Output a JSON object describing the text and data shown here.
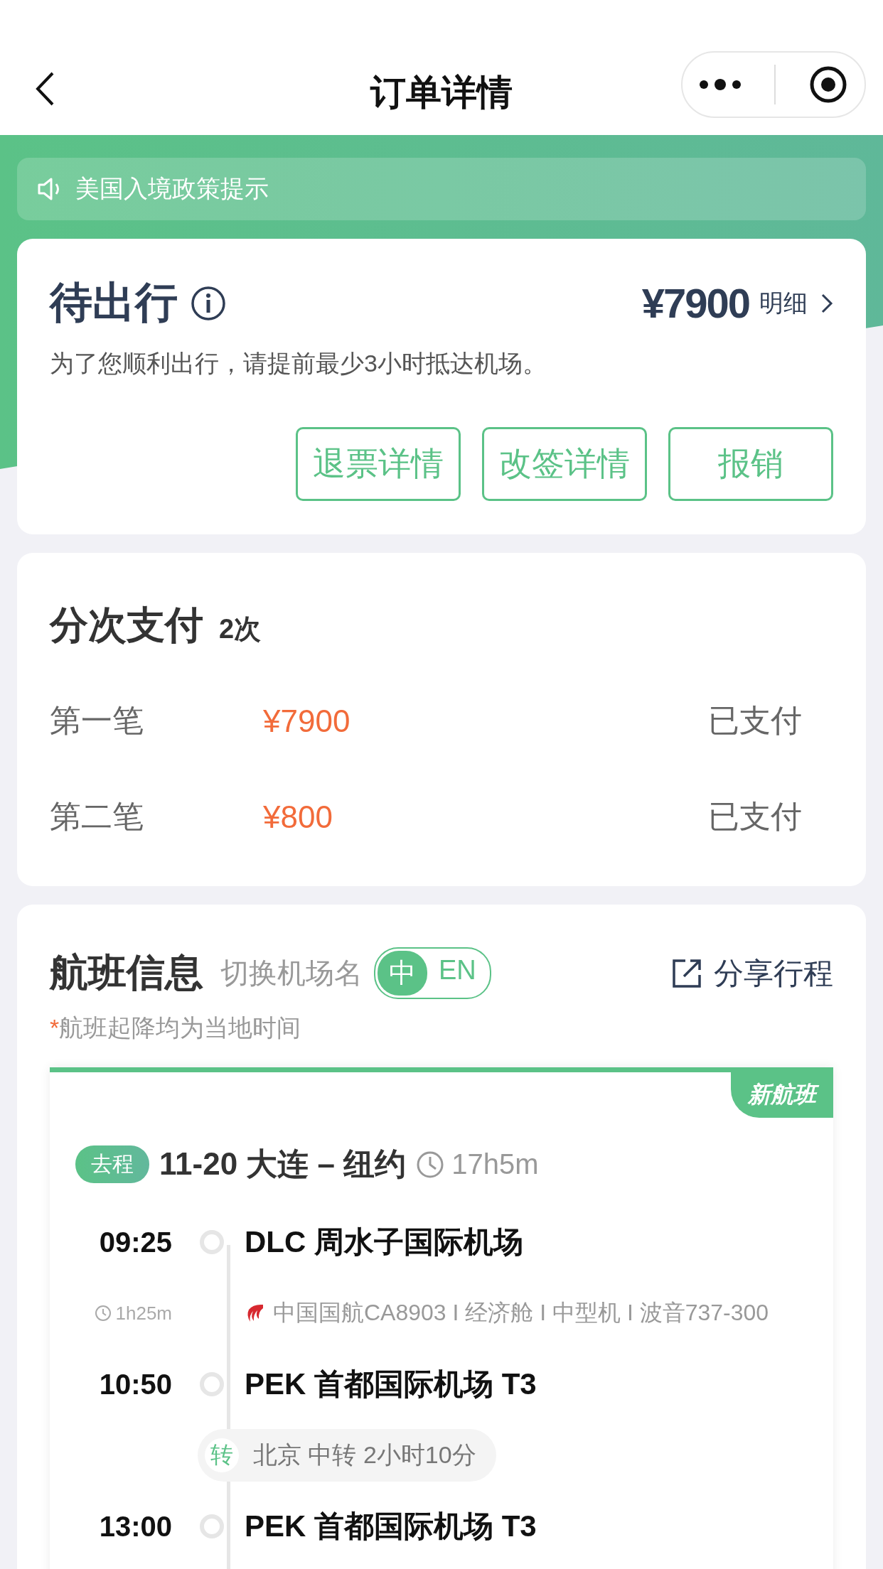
{
  "nav": {
    "title": "订单详情"
  },
  "notice": {
    "text": "美国入境政策提示"
  },
  "order": {
    "status": "待出行",
    "price": "¥7900",
    "detail_link": "明细",
    "hint": "为了您顺利出行，请提前最少3小时抵达机场。",
    "buttons": [
      "退票详情",
      "改签详情",
      "报销"
    ]
  },
  "payments": {
    "title": "分次支付",
    "count": "2次",
    "rows": [
      {
        "label": "第一笔",
        "amount": "¥7900",
        "status": "已支付"
      },
      {
        "label": "第二笔",
        "amount": "¥800",
        "status": "已支付"
      }
    ]
  },
  "flight": {
    "title": "航班信息",
    "switch_label": "切换机场名",
    "language_options": [
      {
        "label": "中",
        "selected": true
      },
      {
        "label": "EN",
        "selected": false
      }
    ],
    "share": "分享行程",
    "note_mark": "*",
    "note": "航班起降均为当地时间",
    "badge": "新航班",
    "segment": {
      "tag": "去程",
      "route": "11-20 大连 – 纽约",
      "duration": "17h5m"
    },
    "timeline": [
      {
        "kind": "stop",
        "time": "09:25",
        "place": "DLC 周水子国际机场"
      },
      {
        "kind": "leg",
        "duration": "1h25m",
        "info": "中国国航CA8903 I 经济舱 I 中型机 I 波音737-300"
      },
      {
        "kind": "stop",
        "time": "10:50",
        "place": "PEK 首都国际机场 T3"
      },
      {
        "kind": "transfer",
        "mark": "转",
        "text": "北京 中转 2小时10分"
      },
      {
        "kind": "stop",
        "time": "13:00",
        "place": "PEK 首都国际机场 T3"
      }
    ]
  }
}
